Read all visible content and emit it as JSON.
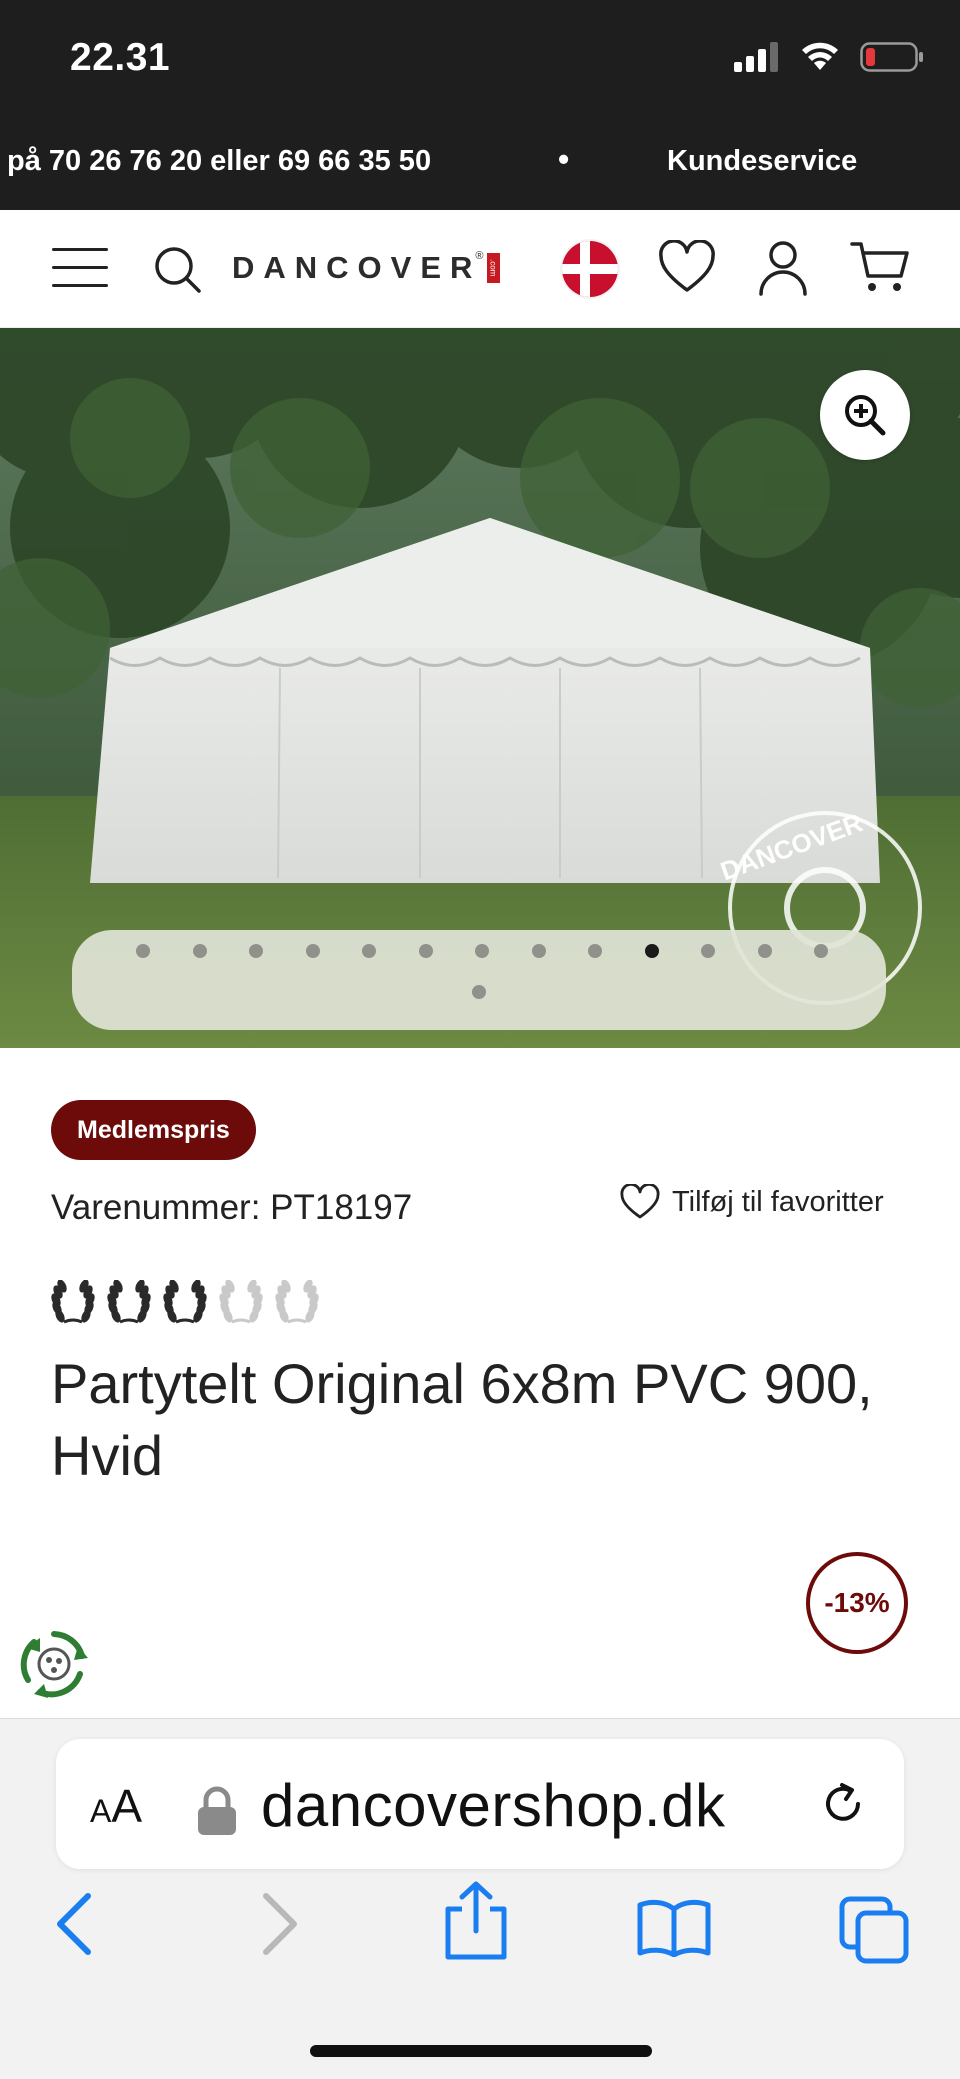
{
  "status_bar": {
    "time": "22.31",
    "icons": [
      "signal-icon",
      "wifi-icon",
      "battery-low-icon"
    ],
    "battery_color": "#e5383b"
  },
  "announcement": {
    "phone_text": "på 70 26 76 20 eller 69 66 35 50",
    "separator": "•",
    "customer_service": "Kundeservice"
  },
  "header": {
    "logo_text": "DANCOVER",
    "logo_reg": "®",
    "logo_com": ".com",
    "icons": [
      "menu-icon",
      "search-icon",
      "denmark-flag-icon",
      "heart-icon",
      "user-icon",
      "cart-icon"
    ]
  },
  "gallery": {
    "dot_count": 14,
    "active_index": 9,
    "zoom_icon": "zoom-in-icon",
    "watermark": "DANCOVER"
  },
  "product": {
    "badge": "Medlemspris",
    "sku_label": "Varenummer: PT18197",
    "favorite_label": "Tilføj til favoritter",
    "rating": 3,
    "rating_max": 5,
    "title": "Partytelt Original 6x8m PVC 900, Hvid",
    "discount": "-13%",
    "accent_color": "#6d0a0a"
  },
  "browser": {
    "text_size_small": "A",
    "text_size_large": "A",
    "url": "dancovershop.dk",
    "toolbar_icons": [
      "back-icon",
      "forward-icon",
      "share-icon",
      "bookmarks-icon",
      "tabs-icon"
    ],
    "accent_color": "#1a7df0"
  }
}
